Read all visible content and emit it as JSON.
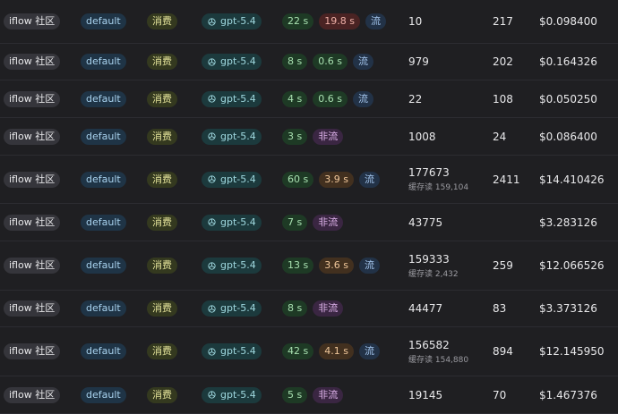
{
  "rows": [
    {
      "channel": "iflow 社区",
      "group": "default",
      "type": "消费",
      "model": "gpt-5.4",
      "time": "22 s",
      "first": "19.8 s",
      "first_color": "red",
      "stream": "流",
      "stream_kind": "stream",
      "prompt": "10",
      "cache": null,
      "completion": "217",
      "cost": "$0.098400"
    },
    {
      "channel": "iflow 社区",
      "group": "default",
      "type": "消费",
      "model": "gpt-5.4",
      "time": "8 s",
      "first": "0.6 s",
      "first_color": "green",
      "stream": "流",
      "stream_kind": "stream",
      "prompt": "979",
      "cache": null,
      "completion": "202",
      "cost": "$0.164326"
    },
    {
      "channel": "iflow 社区",
      "group": "default",
      "type": "消费",
      "model": "gpt-5.4",
      "time": "4 s",
      "first": "0.6 s",
      "first_color": "green",
      "stream": "流",
      "stream_kind": "stream",
      "prompt": "22",
      "cache": null,
      "completion": "108",
      "cost": "$0.050250"
    },
    {
      "channel": "iflow 社区",
      "group": "default",
      "type": "消费",
      "model": "gpt-5.4",
      "time": "3 s",
      "first": null,
      "first_color": null,
      "stream": "非流",
      "stream_kind": "nonstream",
      "prompt": "1008",
      "cache": null,
      "completion": "24",
      "cost": "$0.086400"
    },
    {
      "channel": "iflow 社区",
      "group": "default",
      "type": "消费",
      "model": "gpt-5.4",
      "time": "60 s",
      "first": "3.9 s",
      "first_color": "brown",
      "stream": "流",
      "stream_kind": "stream",
      "prompt": "177673",
      "cache": "缓存读 159,104",
      "completion": "2411",
      "cost": "$14.410426"
    },
    {
      "channel": "iflow 社区",
      "group": "default",
      "type": "消费",
      "model": "gpt-5.4",
      "time": "7 s",
      "first": null,
      "first_color": null,
      "stream": "非流",
      "stream_kind": "nonstream",
      "prompt": "43775",
      "cache": null,
      "completion": "",
      "cost": "$3.283126"
    },
    {
      "channel": "iflow 社区",
      "group": "default",
      "type": "消费",
      "model": "gpt-5.4",
      "time": "13 s",
      "first": "3.6 s",
      "first_color": "brown",
      "stream": "流",
      "stream_kind": "stream",
      "prompt": "159333",
      "cache": "缓存读 2,432",
      "completion": "259",
      "cost": "$12.066526"
    },
    {
      "channel": "iflow 社区",
      "group": "default",
      "type": "消费",
      "model": "gpt-5.4",
      "time": "8 s",
      "first": null,
      "first_color": null,
      "stream": "非流",
      "stream_kind": "nonstream",
      "prompt": "44477",
      "cache": null,
      "completion": "83",
      "cost": "$3.373126"
    },
    {
      "channel": "iflow 社区",
      "group": "default",
      "type": "消费",
      "model": "gpt-5.4",
      "time": "42 s",
      "first": "4.1 s",
      "first_color": "brown",
      "stream": "流",
      "stream_kind": "stream",
      "prompt": "156582",
      "cache": "缓存读 154,880",
      "completion": "894",
      "cost": "$12.145950"
    },
    {
      "channel": "iflow 社区",
      "group": "default",
      "type": "消费",
      "model": "gpt-5.4",
      "time": "5 s",
      "first": null,
      "first_color": null,
      "stream": "非流",
      "stream_kind": "nonstream",
      "prompt": "19145",
      "cache": null,
      "completion": "70",
      "cost": "$1.467376"
    }
  ]
}
